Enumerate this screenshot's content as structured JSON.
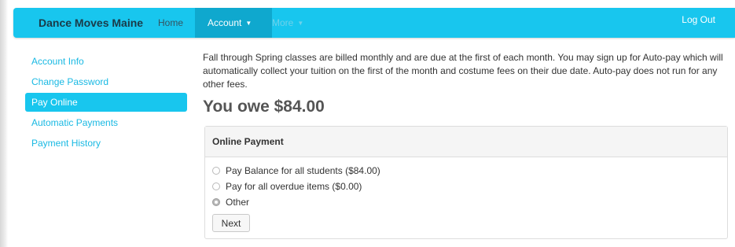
{
  "navbar": {
    "brand": "Dance Moves Maine",
    "links": {
      "home": "Home",
      "account": "Account",
      "more": "More",
      "logout": "Log Out"
    }
  },
  "sidebar": {
    "items": [
      {
        "label": "Account Info"
      },
      {
        "label": "Change Password"
      },
      {
        "label": "Pay Online"
      },
      {
        "label": "Automatic Payments"
      },
      {
        "label": "Payment History"
      }
    ]
  },
  "main": {
    "intro": "Fall through Spring classes are billed monthly and are due at the first of each month. You may sign up for Auto-pay which will automatically collect your tuition on the first of the month and costume fees on their due date. Auto-pay does not run for any other fees.",
    "owe_heading": "You owe $84.00",
    "panel": {
      "title": "Online Payment",
      "options": [
        {
          "label": "Pay Balance for all students ($84.00)",
          "selected": false
        },
        {
          "label": "Pay for all overdue items ($0.00)",
          "selected": false
        },
        {
          "label": "Other",
          "selected": true
        }
      ],
      "next_label": "Next"
    }
  },
  "colors": {
    "navbar": "#18c6ee",
    "navbar_active": "#0fa8ce",
    "sidebar_link": "#19b9e3"
  }
}
